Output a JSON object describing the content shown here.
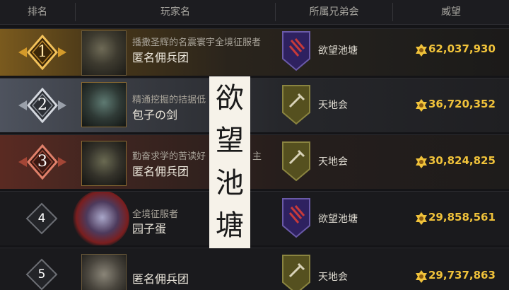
{
  "header": {
    "rank": "排名",
    "player_name": "玩家名",
    "guild": "所属兄弟会",
    "prestige": "威望"
  },
  "rows": [
    {
      "rank": "1",
      "title": "播撒圣辉的名震寰宇全境征服者",
      "name": "匿名佣兵团",
      "guild": "欲望池塘",
      "prestige": "62,037,930"
    },
    {
      "rank": "2",
      "title": "精通挖掘的拮据低",
      "name": "包子の剑",
      "guild": "天地会",
      "prestige": "36,720,352"
    },
    {
      "rank": "3",
      "title": "勤奋求学的苦读好",
      "title_tail": "主",
      "name": "匿名佣兵团",
      "guild": "天地会",
      "prestige": "30,824,825"
    },
    {
      "rank": "4",
      "title": "全境征服者",
      "name": "园子蛋",
      "guild": "欲望池塘",
      "prestige": "29,858,561"
    },
    {
      "rank": "5",
      "title": "",
      "name": "匿名佣兵团",
      "guild": "天地会",
      "prestige": "29,737,863"
    }
  ],
  "overlay_text": [
    "欲",
    "望",
    "池",
    "塘"
  ],
  "colors": {
    "gold": "#f0c23a",
    "purple_banner": "#3b2a6e",
    "olive_banner": "#5a5524",
    "rank1_frame": "#d49a2a",
    "rank2_frame": "#b7bcc6",
    "rank3_frame": "#b04a3a"
  },
  "icons": {
    "prestige": "gold-crest-icon",
    "guild_banner": "banner-icon"
  }
}
